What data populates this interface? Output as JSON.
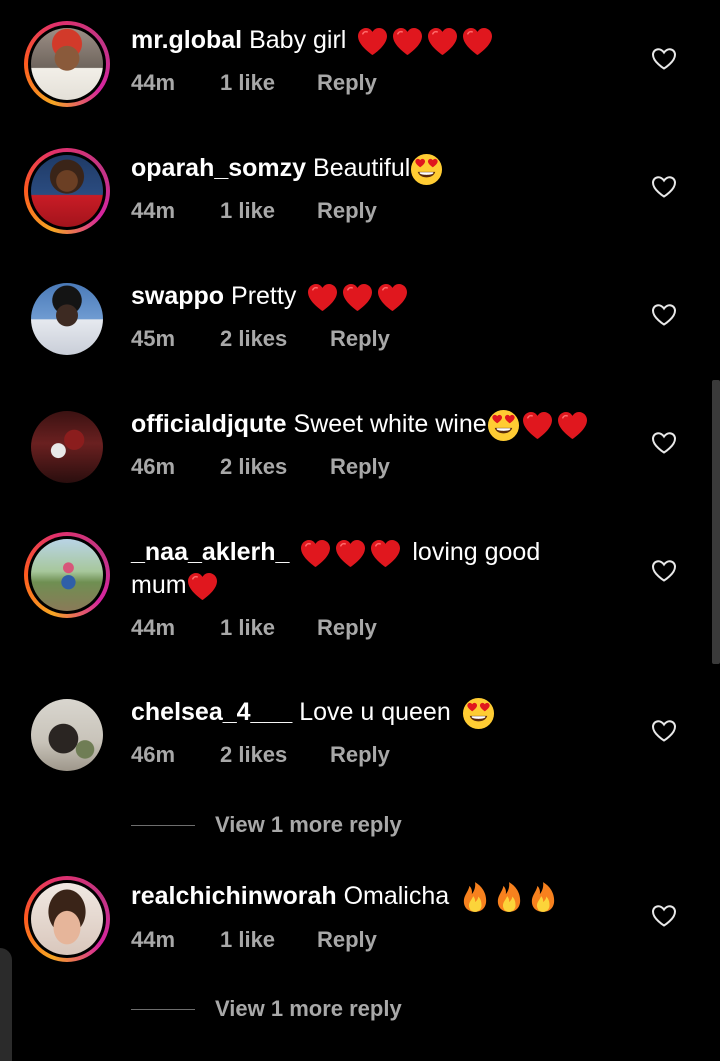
{
  "comments": [
    {
      "username": "mr.global",
      "text": "Baby girl",
      "time": "44m",
      "likes": "1 like",
      "reply": "Reply",
      "story_ring": true
    },
    {
      "username": "oparah_somzy",
      "text": "Beautiful",
      "time": "44m",
      "likes": "1 like",
      "reply": "Reply",
      "story_ring": true
    },
    {
      "username": "swappo",
      "text": "Pretty",
      "time": "45m",
      "likes": "2 likes",
      "reply": "Reply",
      "story_ring": false
    },
    {
      "username": "officialdjqute",
      "text": "Sweet white wine",
      "time": "46m",
      "likes": "2 likes",
      "reply": "Reply",
      "story_ring": false
    },
    {
      "username": "_naa_aklerh_",
      "text": "loving good",
      "text2": "mum",
      "time": "44m",
      "likes": "1 like",
      "reply": "Reply",
      "story_ring": true
    },
    {
      "username": "chelsea_4___",
      "text": "Love u queen",
      "time": "46m",
      "likes": "2 likes",
      "reply": "Reply",
      "story_ring": false,
      "view_more": "View 1 more reply"
    },
    {
      "username": "realchichinworah",
      "text": "Omalicha",
      "time": "44m",
      "likes": "1 like",
      "reply": "Reply",
      "story_ring": true,
      "view_more": "View 1 more reply"
    }
  ],
  "icons": {
    "like": "heart-outline-icon",
    "red_heart": "red-heart-emoji",
    "heart_eyes": "heart-eyes-emoji",
    "fire": "fire-emoji"
  },
  "colors": {
    "background": "#000000",
    "text": "#ffffff",
    "meta": "#a8a8a8",
    "heart_emoji": "#e0171e"
  }
}
